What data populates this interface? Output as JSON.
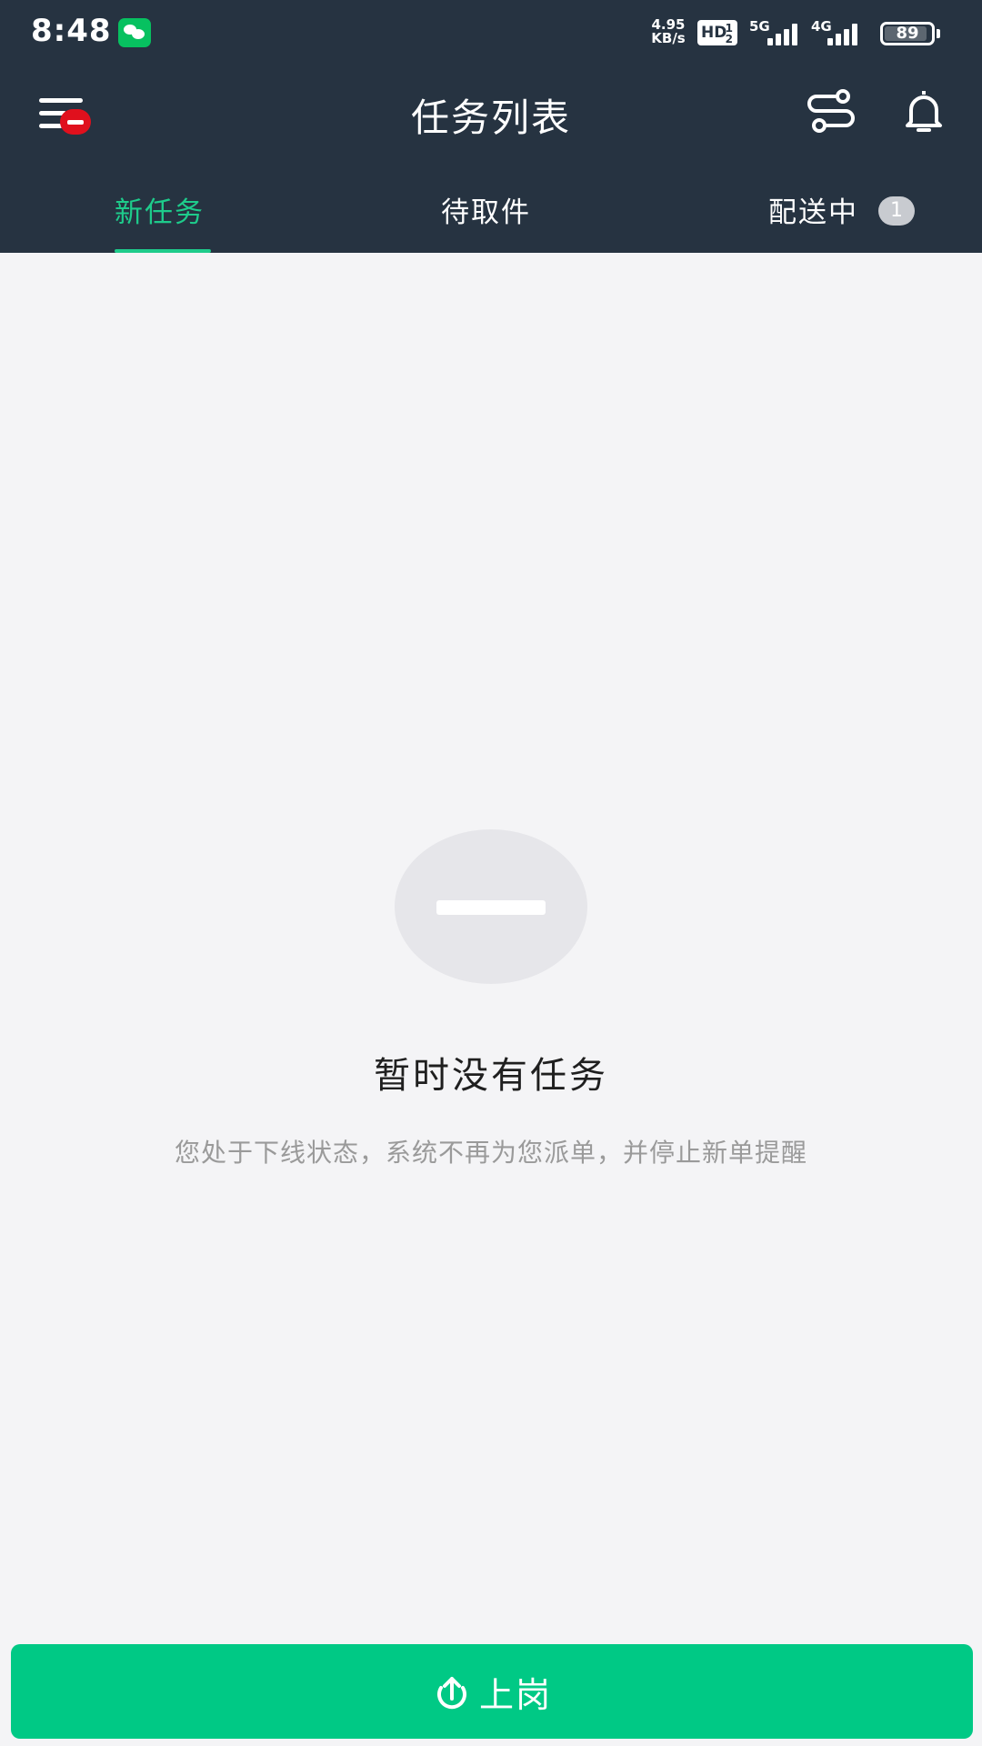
{
  "status_bar": {
    "time": "8:48",
    "net_speed_value": "4.95",
    "net_speed_unit": "KB/s",
    "hd_label": "HD",
    "hd_sup": "1",
    "hd_sub": "2",
    "network_1": "5G",
    "network_2": "4G",
    "battery": "89",
    "app_icon": "wechat-icon"
  },
  "header": {
    "title": "任务列表",
    "menu_icon": "menu-icon",
    "route_icon": "route-icon",
    "bell_icon": "bell-icon"
  },
  "tabs": [
    {
      "label": "新任务",
      "active": true
    },
    {
      "label": "待取件",
      "active": false
    },
    {
      "label": "配送中",
      "active": false,
      "count": "1"
    }
  ],
  "empty_state": {
    "title": "暂时没有任务",
    "description": "您处于下线状态，系统不再为您派单，并停止新单提醒"
  },
  "bottom_button": {
    "label": "上岗",
    "icon": "upload-icon"
  },
  "colors": {
    "header_bg": "#263341",
    "accent": "#1ecb8b",
    "button_bg": "#00c985",
    "page_bg": "#f4f4f6"
  }
}
